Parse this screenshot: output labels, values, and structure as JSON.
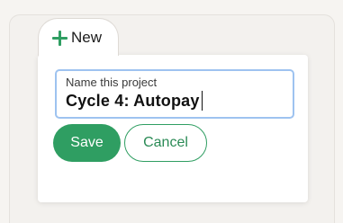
{
  "new_button": {
    "label": "New",
    "icon": "plus-icon",
    "icon_color": "#2f9e62"
  },
  "project_form": {
    "field_label": "Name this project",
    "field_value": "Cycle 4: Autopay",
    "field_focus_color": "#9ec3f0",
    "save_label": "Save",
    "cancel_label": "Cancel",
    "accent_color": "#2f9e62"
  }
}
